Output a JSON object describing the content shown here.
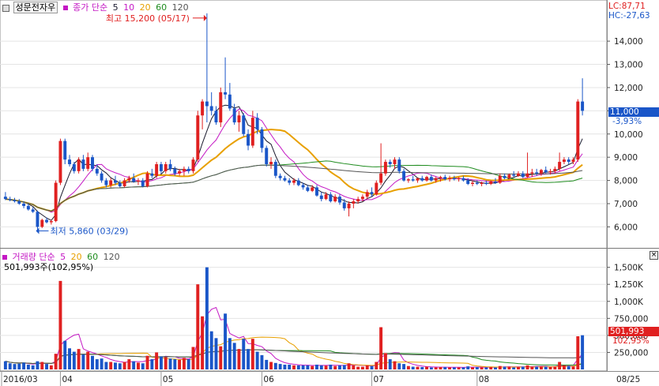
{
  "title": "성문전자우",
  "price_legend": {
    "label": "종가 단순",
    "ma": [
      "5",
      "10",
      "20",
      "60",
      "120"
    ]
  },
  "volume_legend": {
    "label": "거래량 단순",
    "ma": [
      "5",
      "20",
      "60",
      "120"
    ]
  },
  "volume_info": "501,993주(102,95%)",
  "lc": "LC:87,71",
  "hc": "HC:-27,63",
  "high_annotation": "최고 15,200 (05/17)",
  "low_annotation": "최저 5,860 (03/29)",
  "current_price": "11,000",
  "current_change": "-3,93%",
  "current_volume": "501,993",
  "current_volume_pct": "102,95%",
  "date_labels": [
    "2016/03",
    "04",
    "05",
    "06",
    "07",
    "08",
    "08/25"
  ],
  "colors": {
    "up": "#e02020",
    "down": "#1a56c8",
    "ma5": "#1a1a2e",
    "ma10": "#c418c4",
    "ma20": "#e8a000",
    "ma60": "#1f8c1f",
    "ma120": "#555555"
  },
  "chart_data": {
    "type": "candlestick",
    "price_ticks": [
      6000,
      7000,
      8000,
      9000,
      10000,
      11000,
      12000,
      13000,
      14000
    ],
    "volume_ticks": [
      "250,000",
      "500,000",
      "750,000",
      "1,000K",
      "1,250K",
      "1,500K"
    ],
    "volume_tick_values": [
      250000,
      500000,
      750000,
      1000000,
      1250000,
      1500000
    ],
    "price_range": [
      5300,
      15500
    ],
    "volume_range": [
      0,
      1600000
    ],
    "candles": [
      [
        7300,
        7500,
        7150,
        7200,
        120000
      ],
      [
        7200,
        7300,
        7100,
        7150,
        90000
      ],
      [
        7150,
        7250,
        7050,
        7100,
        80000
      ],
      [
        7100,
        7200,
        6950,
        7000,
        85000
      ],
      [
        7000,
        7100,
        6800,
        6900,
        100000
      ],
      [
        6900,
        7000,
        6700,
        6750,
        70000
      ],
      [
        6750,
        6850,
        6600,
        6650,
        60000
      ],
      [
        6650,
        6700,
        5860,
        6000,
        120000
      ],
      [
        6000,
        6350,
        5950,
        6300,
        110000
      ],
      [
        6300,
        6400,
        6150,
        6200,
        80000
      ],
      [
        6200,
        6300,
        6100,
        6250,
        60000
      ],
      [
        6250,
        8000,
        6200,
        7900,
        230000
      ],
      [
        7900,
        9800,
        7800,
        9700,
        1300000
      ],
      [
        9700,
        9800,
        8700,
        8900,
        420000
      ],
      [
        8900,
        9100,
        8600,
        8700,
        310000
      ],
      [
        8700,
        8800,
        8300,
        8400,
        260000
      ],
      [
        8400,
        9000,
        8300,
        8900,
        300000
      ],
      [
        8900,
        9100,
        8400,
        8500,
        220000
      ],
      [
        8500,
        9200,
        8400,
        9000,
        260000
      ],
      [
        9000,
        9100,
        8400,
        8500,
        200000
      ],
      [
        8500,
        8700,
        8200,
        8300,
        150000
      ],
      [
        8300,
        8400,
        7900,
        8000,
        160000
      ],
      [
        8000,
        8100,
        7700,
        7800,
        110000
      ],
      [
        7800,
        8100,
        7700,
        8000,
        110000
      ],
      [
        8000,
        8200,
        7800,
        7900,
        100000
      ],
      [
        7900,
        8000,
        7700,
        7750,
        90000
      ],
      [
        7750,
        8100,
        7700,
        8000,
        110000
      ],
      [
        8000,
        8200,
        7900,
        8100,
        150000
      ],
      [
        8100,
        8300,
        7900,
        7950,
        120000
      ],
      [
        7950,
        8100,
        7800,
        8000,
        100000
      ],
      [
        8000,
        8100,
        7700,
        7750,
        90000
      ],
      [
        7750,
        8400,
        7700,
        8300,
        200000
      ],
      [
        8300,
        8500,
        8100,
        8200,
        150000
      ],
      [
        8200,
        8800,
        8100,
        8700,
        250000
      ],
      [
        8700,
        8800,
        8300,
        8400,
        190000
      ],
      [
        8400,
        8800,
        8300,
        8700,
        180000
      ],
      [
        8700,
        8900,
        8400,
        8500,
        160000
      ],
      [
        8500,
        8600,
        8200,
        8300,
        150000
      ],
      [
        8300,
        8500,
        8200,
        8400,
        140000
      ],
      [
        8400,
        8600,
        8200,
        8500,
        170000
      ],
      [
        8500,
        8600,
        8300,
        8400,
        150000
      ],
      [
        8400,
        9000,
        8300,
        8900,
        330000
      ],
      [
        8900,
        11000,
        8800,
        10800,
        1250000
      ],
      [
        10800,
        11500,
        10200,
        11400,
        780000
      ],
      [
        11400,
        15200,
        10500,
        11200,
        1500000
      ],
      [
        11200,
        11800,
        10800,
        11000,
        560000
      ],
      [
        11000,
        11200,
        10400,
        10500,
        460000
      ],
      [
        10500,
        12000,
        10300,
        11800,
        340000
      ],
      [
        11800,
        13300,
        11500,
        11700,
        820000
      ],
      [
        11700,
        12200,
        11000,
        11100,
        460000
      ],
      [
        11100,
        11300,
        10400,
        10500,
        390000
      ],
      [
        10500,
        11000,
        10100,
        10800,
        300000
      ],
      [
        10800,
        10900,
        9900,
        10000,
        450000
      ],
      [
        10000,
        10200,
        9300,
        9500,
        300000
      ],
      [
        9500,
        11000,
        9400,
        10700,
        450000
      ],
      [
        10700,
        10900,
        10000,
        10200,
        260000
      ],
      [
        10200,
        10300,
        9200,
        9400,
        210000
      ],
      [
        9400,
        9500,
        8600,
        8700,
        140000
      ],
      [
        8700,
        9000,
        8500,
        8800,
        110000
      ],
      [
        8800,
        8900,
        8100,
        8200,
        95000
      ],
      [
        8200,
        8300,
        8000,
        8100,
        80000
      ],
      [
        8100,
        8200,
        7950,
        8000,
        70000
      ],
      [
        8000,
        8100,
        7800,
        7900,
        70000
      ],
      [
        7900,
        8100,
        7800,
        8000,
        60000
      ],
      [
        8000,
        8100,
        7750,
        7800,
        60000
      ],
      [
        7800,
        7900,
        7600,
        7700,
        60000
      ],
      [
        7700,
        7800,
        7500,
        7550,
        60000
      ],
      [
        7550,
        7800,
        7500,
        7700,
        50000
      ],
      [
        7700,
        7800,
        7300,
        7350,
        70000
      ],
      [
        7350,
        7500,
        7100,
        7200,
        60000
      ],
      [
        7200,
        7500,
        7150,
        7400,
        55000
      ],
      [
        7400,
        7500,
        7050,
        7100,
        70000
      ],
      [
        7100,
        7400,
        7050,
        7300,
        50000
      ],
      [
        7300,
        7400,
        6950,
        7050,
        60000
      ],
      [
        7050,
        7200,
        6700,
        6800,
        65000
      ],
      [
        6800,
        7100,
        6450,
        7000,
        90000
      ],
      [
        7000,
        7200,
        6800,
        7100,
        60000
      ],
      [
        7100,
        7300,
        7000,
        7200,
        40000
      ],
      [
        7200,
        7400,
        7100,
        7300,
        40000
      ],
      [
        7300,
        7600,
        7200,
        7500,
        60000
      ],
      [
        7500,
        7700,
        7300,
        7400,
        50000
      ],
      [
        7400,
        8000,
        7350,
        7900,
        110000
      ],
      [
        7900,
        9600,
        7800,
        8300,
        620000
      ],
      [
        8300,
        8900,
        8200,
        8800,
        240000
      ],
      [
        8800,
        8900,
        8550,
        8700,
        150000
      ],
      [
        8700,
        9000,
        8500,
        8900,
        120000
      ],
      [
        8900,
        9000,
        8300,
        8400,
        90000
      ],
      [
        8400,
        8500,
        7950,
        8000,
        80000
      ],
      [
        8000,
        8100,
        7900,
        8050,
        50000
      ],
      [
        8050,
        8200,
        7950,
        8000,
        40000
      ],
      [
        8000,
        8100,
        7900,
        8100,
        40000
      ],
      [
        8100,
        8200,
        7950,
        8000,
        35000
      ],
      [
        8000,
        8200,
        7950,
        8150,
        40000
      ],
      [
        8150,
        8250,
        7950,
        8000,
        30000
      ],
      [
        8000,
        8150,
        7900,
        8100,
        30000
      ],
      [
        8100,
        8200,
        7950,
        8150,
        35000
      ],
      [
        8150,
        8250,
        8000,
        8050,
        35000
      ],
      [
        8050,
        8200,
        7950,
        8100,
        30000
      ],
      [
        8100,
        8200,
        8000,
        8050,
        30000
      ],
      [
        8050,
        8150,
        7950,
        8100,
        30000
      ],
      [
        8100,
        8200,
        7950,
        8000,
        30000
      ],
      [
        8000,
        8100,
        7800,
        7850,
        45000
      ],
      [
        7850,
        8000,
        7750,
        7900,
        30000
      ],
      [
        7900,
        8000,
        7800,
        7850,
        35000
      ],
      [
        7850,
        7950,
        7750,
        7900,
        30000
      ],
      [
        7900,
        8000,
        7800,
        7850,
        30000
      ],
      [
        7850,
        8000,
        7800,
        7950,
        35000
      ],
      [
        7950,
        8100,
        7850,
        7900,
        30000
      ],
      [
        7900,
        8300,
        7850,
        8200,
        50000
      ],
      [
        8200,
        8300,
        8050,
        8100,
        40000
      ],
      [
        8100,
        8300,
        8050,
        8250,
        40000
      ],
      [
        8250,
        8400,
        8150,
        8200,
        30000
      ],
      [
        8200,
        8400,
        8150,
        8300,
        35000
      ],
      [
        8300,
        8400,
        8100,
        8150,
        40000
      ],
      [
        8150,
        9200,
        8100,
        8300,
        60000
      ],
      [
        8300,
        8500,
        8150,
        8350,
        40000
      ],
      [
        8350,
        8500,
        8200,
        8300,
        40000
      ],
      [
        8300,
        8500,
        8200,
        8450,
        45000
      ],
      [
        8450,
        8600,
        8300,
        8350,
        40000
      ],
      [
        8350,
        8500,
        8250,
        8400,
        35000
      ],
      [
        8400,
        8600,
        8300,
        8500,
        40000
      ],
      [
        8500,
        9200,
        8400,
        8800,
        110000
      ],
      [
        8800,
        9000,
        8700,
        8900,
        60000
      ],
      [
        8900,
        9000,
        8700,
        8800,
        50000
      ],
      [
        8800,
        9000,
        8700,
        8900,
        45000
      ],
      [
        8900,
        11500,
        8800,
        11400,
        487000
      ],
      [
        11400,
        12400,
        10800,
        11000,
        501993
      ]
    ]
  }
}
